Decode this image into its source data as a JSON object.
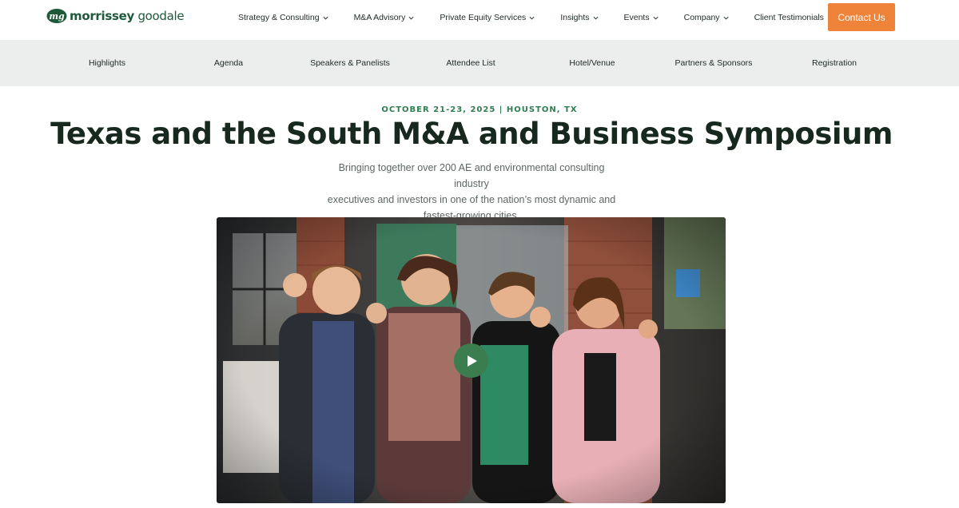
{
  "brand": {
    "name_bold": "morrissey",
    "name_light": " goodale",
    "mark": "mg",
    "color": "#1e5a3a"
  },
  "main_nav": [
    {
      "label": "Strategy & Consulting",
      "has_dropdown": true
    },
    {
      "label": "M&A Advisory",
      "has_dropdown": true
    },
    {
      "label": "Private Equity Services",
      "has_dropdown": true
    },
    {
      "label": "Insights",
      "has_dropdown": true
    },
    {
      "label": "Events",
      "has_dropdown": true
    },
    {
      "label": "Company",
      "has_dropdown": true
    },
    {
      "label": "Client Testimonials",
      "has_dropdown": false
    }
  ],
  "contact_button": {
    "label": "Contact Us",
    "color": "#f0833a"
  },
  "sub_nav": [
    {
      "label": "Highlights"
    },
    {
      "label": "Agenda"
    },
    {
      "label": "Speakers & Panelists"
    },
    {
      "label": "Attendee List"
    },
    {
      "label": "Hotel/Venue"
    },
    {
      "label": "Partners & Sponsors"
    },
    {
      "label": "Registration"
    }
  ],
  "hero": {
    "event_date": "OCTOBER 21-23, 2025 | HOUSTON, TX",
    "title": "Texas and the South M&A and Business Symposium",
    "intro_lines": [
      "Bringing together over 200 AE and environmental consulting industry",
      "executives and investors in one of the nation’s most dynamic and",
      "fastest-growing cities."
    ]
  },
  "video": {
    "play_icon": "play-icon",
    "accent_color": "#3b7d4f"
  }
}
